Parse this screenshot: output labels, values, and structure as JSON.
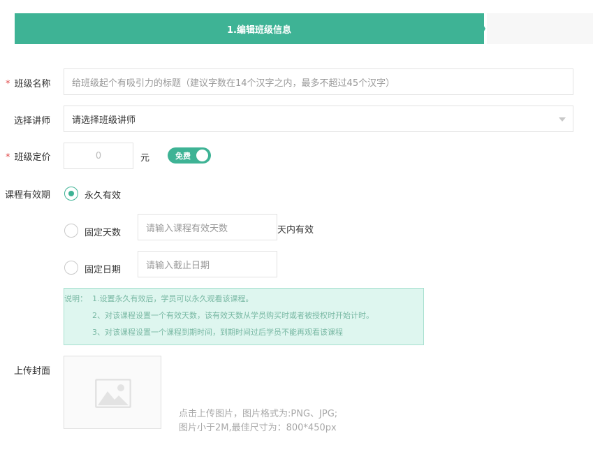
{
  "steps": {
    "active_label": "1.编辑班级信息"
  },
  "form": {
    "name": {
      "required_mark": "*",
      "label": "班级名称",
      "placeholder": "给班级起个有吸引力的标题（建议字数在14个汉字之内，最多不超过45个汉字）"
    },
    "teacher": {
      "label": "选择讲师",
      "value": "请选择班级讲师"
    },
    "price": {
      "required_mark": "*",
      "label": "班级定价",
      "value": "0",
      "unit": "元",
      "toggle_label": "免费",
      "toggle_on": true
    },
    "validity": {
      "label": "课程有效期",
      "options": [
        {
          "label": "永久有效",
          "checked": true
        },
        {
          "label": "固定天数",
          "checked": false,
          "placeholder": "请输入课程有效天数",
          "suffix": "天内有效"
        },
        {
          "label": "固定日期",
          "checked": false,
          "placeholder": "请输入截止日期"
        }
      ],
      "note": {
        "prefix": "说明：",
        "lines": [
          "1.设置永久有效后，学员可以永久观看该课程。",
          "2、对该课程设置一个有效天数，该有效天数从学员购买时或者被授权时开始计时。",
          "3、对该课程设置一个课程到期时间，到期时间过后学员不能再观看该课程"
        ]
      }
    },
    "cover": {
      "label": "上传封面",
      "hint_lines": [
        "点击上传图片，图片格式为:PNG、JPG;",
        "图片小于2M,最佳尺寸为：800*450px"
      ]
    }
  },
  "colors": {
    "accent": "#3eb395",
    "required": "#e04848",
    "note_bg": "#def6ef"
  }
}
